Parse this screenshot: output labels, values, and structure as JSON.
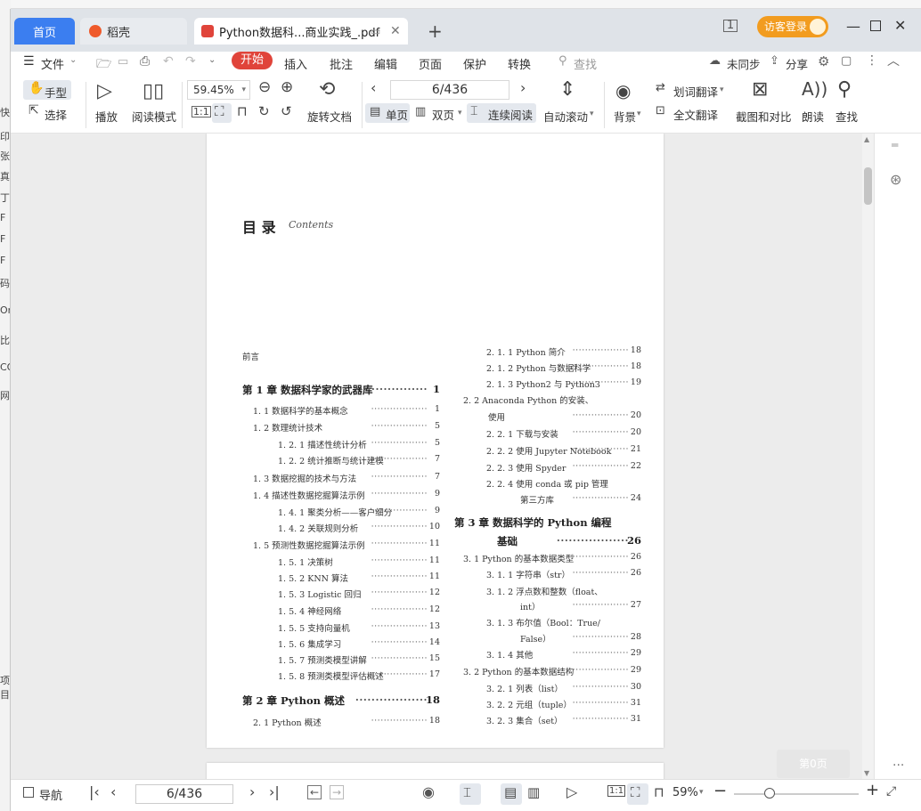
{
  "window": {
    "tabs": [
      {
        "label": "首页"
      },
      {
        "label": "稻壳"
      },
      {
        "label": "Python数据科...商业实践_.pdf"
      }
    ],
    "login": "访客登录",
    "accent": "#3b7ef0"
  },
  "menu": {
    "file": "文件",
    "items": [
      "开始",
      "插入",
      "批注",
      "编辑",
      "页面",
      "保护",
      "转换"
    ],
    "search": "查找",
    "sync": "未同步",
    "share": "分享"
  },
  "ribbon": {
    "hand": "手型",
    "select": "选择",
    "play": "播放",
    "read_mode": "阅读模式",
    "zoom": "59.45%",
    "rotate": "旋转文档",
    "page": "6/436",
    "single": "单页",
    "double": "双页",
    "continuous": "连续阅读",
    "auto_scroll": "自动滚动",
    "bg": "背景",
    "word_translate": "划词翻译",
    "full_translate": "全文翻译",
    "screenshot": "截图和对比",
    "read_aloud": "朗读",
    "find": "查找"
  },
  "status": {
    "nav": "导航",
    "page": "6/436",
    "zoom": "59%",
    "first_page_btn": "第0页"
  },
  "bg_strip": [
    "快",
    "印",
    "张",
    "真",
    "丁",
    "F",
    "F",
    "F",
    "码",
    "Or",
    "比",
    "CO",
    "网",
    "项目"
  ],
  "doc": {
    "title": "目  录",
    "title_en": "Contents",
    "left": [
      {
        "t": "前言",
        "c": "",
        "p": ""
      },
      {
        "t": "第 1 章   数据科学家的武器库",
        "c": "ch",
        "p": "1"
      },
      {
        "t": "1. 1   数据科学的基本概念",
        "c": "",
        "p": "1"
      },
      {
        "t": "1. 2   数理统计技术",
        "c": "",
        "p": "5"
      },
      {
        "t": "1. 2. 1   描述性统计分析",
        "c": "s",
        "p": "5"
      },
      {
        "t": "1. 2. 2   统计推断与统计建模",
        "c": "s",
        "p": "7"
      },
      {
        "t": "1. 3   数据挖掘的技术与方法",
        "c": "",
        "p": "7"
      },
      {
        "t": "1. 4   描述性数据挖掘算法示例",
        "c": "",
        "p": "9"
      },
      {
        "t": "1. 4. 1   聚类分析——客户细分",
        "c": "s",
        "p": "9"
      },
      {
        "t": "1. 4. 2   关联规则分析",
        "c": "s",
        "p": "10"
      },
      {
        "t": "1. 5   预测性数据挖掘算法示例",
        "c": "",
        "p": "11"
      },
      {
        "t": "1. 5. 1   决策树",
        "c": "s",
        "p": "11"
      },
      {
        "t": "1. 5. 2   KNN 算法",
        "c": "s",
        "p": "11"
      },
      {
        "t": "1. 5. 3   Logistic 回归",
        "c": "s",
        "p": "12"
      },
      {
        "t": "1. 5. 4   神经网络",
        "c": "s",
        "p": "12"
      },
      {
        "t": "1. 5. 5   支持向量机",
        "c": "s",
        "p": "13"
      },
      {
        "t": "1. 5. 6   集成学习",
        "c": "s",
        "p": "14"
      },
      {
        "t": "1. 5. 7   预测类模型讲解",
        "c": "s",
        "p": "15"
      },
      {
        "t": "1. 5. 8   预测类模型评估概述",
        "c": "s",
        "p": "17"
      },
      {
        "t": "第 2 章   Python 概述",
        "c": "ch",
        "p": "18"
      },
      {
        "t": "2. 1   Python 概述",
        "c": "",
        "p": "18"
      }
    ],
    "right": [
      {
        "t": "2. 1. 1   Python 简介",
        "c": "s",
        "p": "18"
      },
      {
        "t": "2. 1. 2   Python 与数据科学",
        "c": "s",
        "p": "18"
      },
      {
        "t": "2. 1. 3   Python2 与 Python3",
        "c": "s",
        "p": "19"
      },
      {
        "t": "2. 2   Anaconda Python 的安装、",
        "c": "",
        "p": ""
      },
      {
        "t": "使用",
        "c": "i",
        "p": "20"
      },
      {
        "t": "2. 2. 1   下载与安装",
        "c": "s",
        "p": "20"
      },
      {
        "t": "2. 2. 2   使用 Jupyter Notebook",
        "c": "s",
        "p": "21"
      },
      {
        "t": "2. 2. 3   使用 Spyder",
        "c": "s",
        "p": "22"
      },
      {
        "t": "2. 2. 4   使用 conda 或 pip 管理",
        "c": "s",
        "p": ""
      },
      {
        "t": "第三方库",
        "c": "i2",
        "p": "24"
      },
      {
        "t": "第 3 章   数据科学的 Python 编程",
        "c": "ch",
        "p": ""
      },
      {
        "t": "基础",
        "c": "chi",
        "p": "26"
      },
      {
        "t": "3. 1   Python 的基本数据类型",
        "c": "",
        "p": "26"
      },
      {
        "t": "3. 1. 1   字符串（str）",
        "c": "s",
        "p": "26"
      },
      {
        "t": "3. 1. 2   浮点数和整数（float、",
        "c": "s",
        "p": ""
      },
      {
        "t": "int）",
        "c": "i2",
        "p": "27"
      },
      {
        "t": "3. 1. 3   布尔值（Bool：True/",
        "c": "s",
        "p": ""
      },
      {
        "t": "False）",
        "c": "i2",
        "p": "28"
      },
      {
        "t": "3. 1. 4   其他",
        "c": "s",
        "p": "29"
      },
      {
        "t": "3. 2   Python 的基本数据结构",
        "c": "",
        "p": "29"
      },
      {
        "t": "3. 2. 1   列表（list）",
        "c": "s",
        "p": "30"
      },
      {
        "t": "3. 2. 2   元组（tuple）",
        "c": "s",
        "p": "31"
      },
      {
        "t": "3. 2. 3   集合（set）",
        "c": "s",
        "p": "31"
      }
    ]
  }
}
